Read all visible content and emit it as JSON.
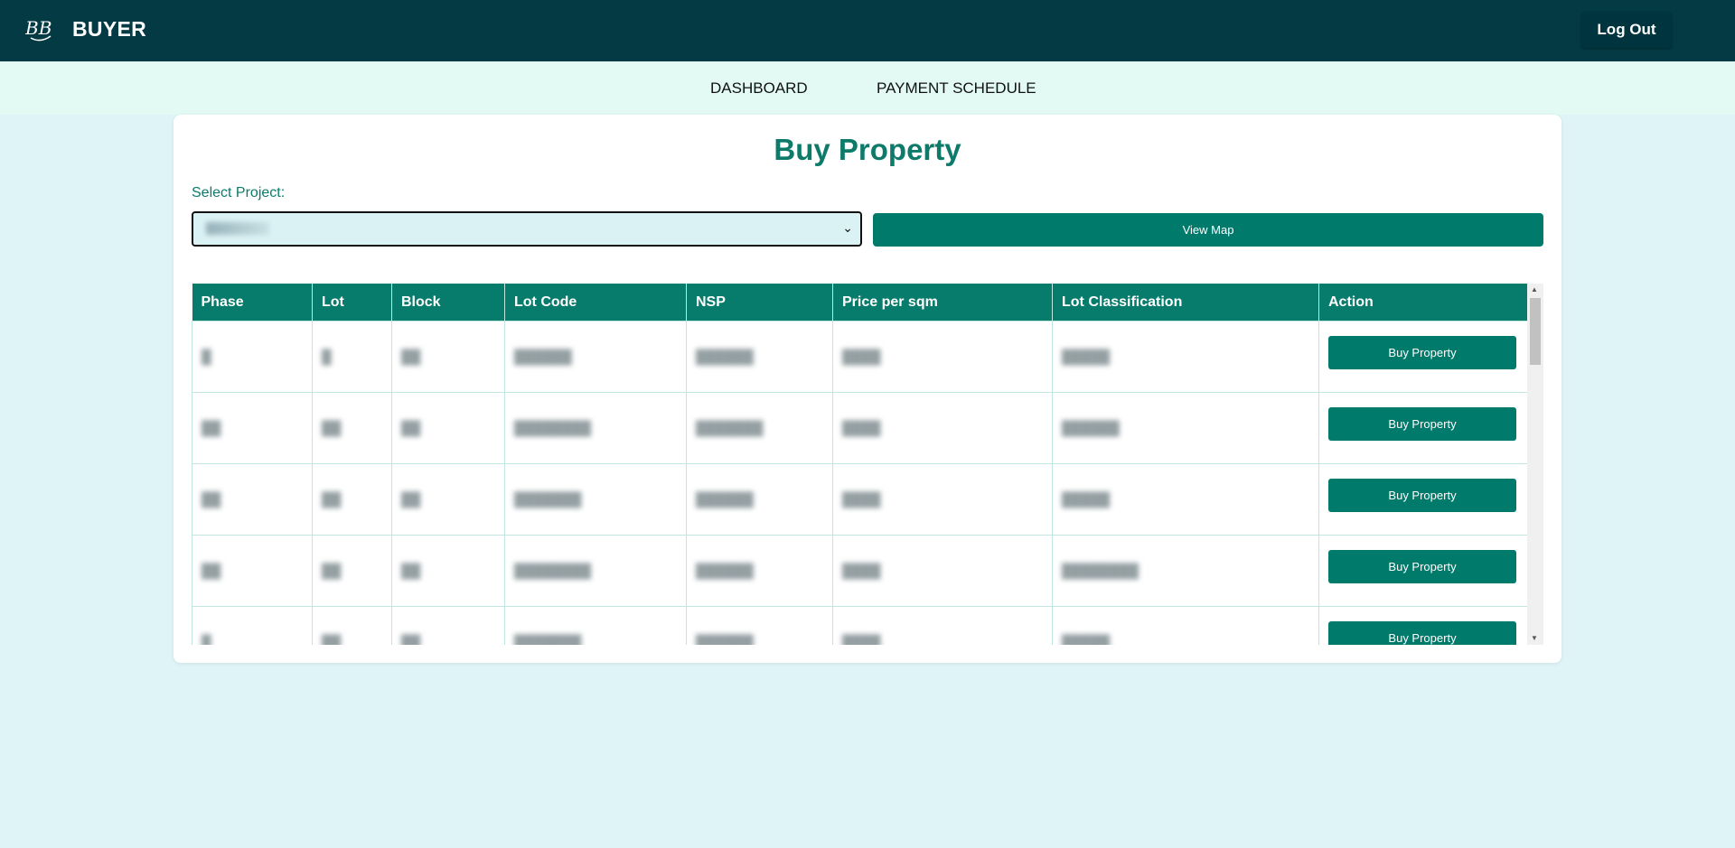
{
  "header": {
    "brand": "BUYER",
    "logout_label": "Log Out",
    "logo_text": "BB"
  },
  "nav": {
    "items": [
      {
        "label": "DASHBOARD"
      },
      {
        "label": "PAYMENT SCHEDULE"
      }
    ]
  },
  "main": {
    "title": "Buy Property",
    "select_label": "Select Project:",
    "select_value": "████ ██",
    "view_map_label": "View Map"
  },
  "table": {
    "columns": [
      "Phase",
      "Lot",
      "Block",
      "Lot Code",
      "NSP",
      "Price per sqm",
      "Lot Classification",
      "Action"
    ],
    "rows": [
      {
        "phase": "█",
        "lot": "█",
        "block": "██",
        "lot_code": "██████",
        "nsp": "██████",
        "price": "████",
        "classification": "█████",
        "action": "Buy Property"
      },
      {
        "phase": "██",
        "lot": "██",
        "block": "██",
        "lot_code": "████████",
        "nsp": "███████",
        "price": "████",
        "classification": "██████",
        "action": "Buy Property"
      },
      {
        "phase": "██",
        "lot": "██",
        "block": "██",
        "lot_code": "███████",
        "nsp": "██████",
        "price": "████",
        "classification": "█████",
        "action": "Buy Property"
      },
      {
        "phase": "██",
        "lot": "██",
        "block": "██",
        "lot_code": "████████",
        "nsp": "██████",
        "price": "████",
        "classification": "████████",
        "action": "Buy Property"
      },
      {
        "phase": "█",
        "lot": "██",
        "block": "██",
        "lot_code": "███████",
        "nsp": "██████",
        "price": "████",
        "classification": "█████",
        "action": "Buy Property"
      }
    ]
  },
  "colors": {
    "header_bg": "#033a44",
    "accent": "#007a6b",
    "page_bg": "#dff4f6"
  }
}
